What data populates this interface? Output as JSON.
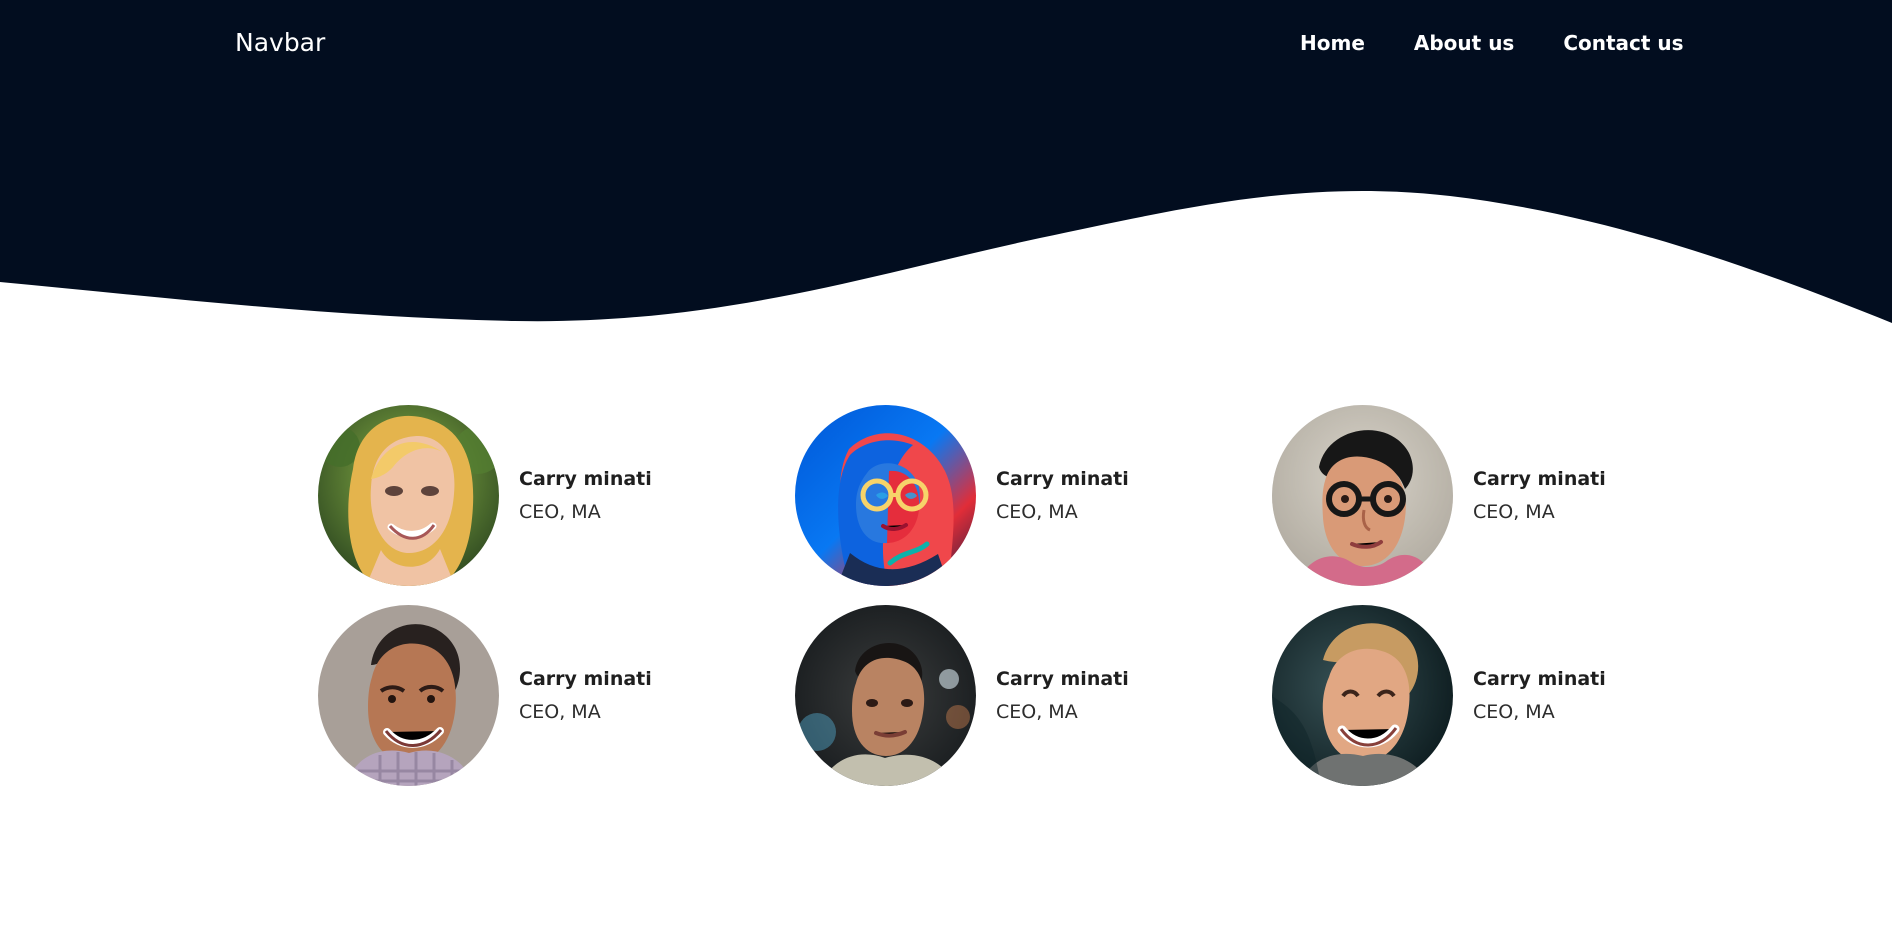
{
  "brand": {
    "name": "Navbar"
  },
  "navigation": {
    "links": [
      "Home",
      "About us",
      "Contact us"
    ]
  },
  "team": [
    {
      "name": "Carry minati",
      "role": "CEO, MA",
      "avatar": "blonde-woman-portrait"
    },
    {
      "name": "Carry minati",
      "role": "CEO, MA",
      "avatar": "neon-woman-portrait"
    },
    {
      "name": "Carry minati",
      "role": "CEO, MA",
      "avatar": "glasses-man-portrait"
    },
    {
      "name": "Carry minati",
      "role": "CEO, MA",
      "avatar": "smiling-man-portrait"
    },
    {
      "name": "Carry minati",
      "role": "CEO, MA",
      "avatar": "city-night-portrait"
    },
    {
      "name": "Carry minati",
      "role": "CEO, MA",
      "avatar": "cheerful-man-portrait"
    }
  ],
  "theme": {
    "navbar_background": "#020d1f",
    "page_background": "#ffffff",
    "text_dark": "#1f1f1f"
  }
}
